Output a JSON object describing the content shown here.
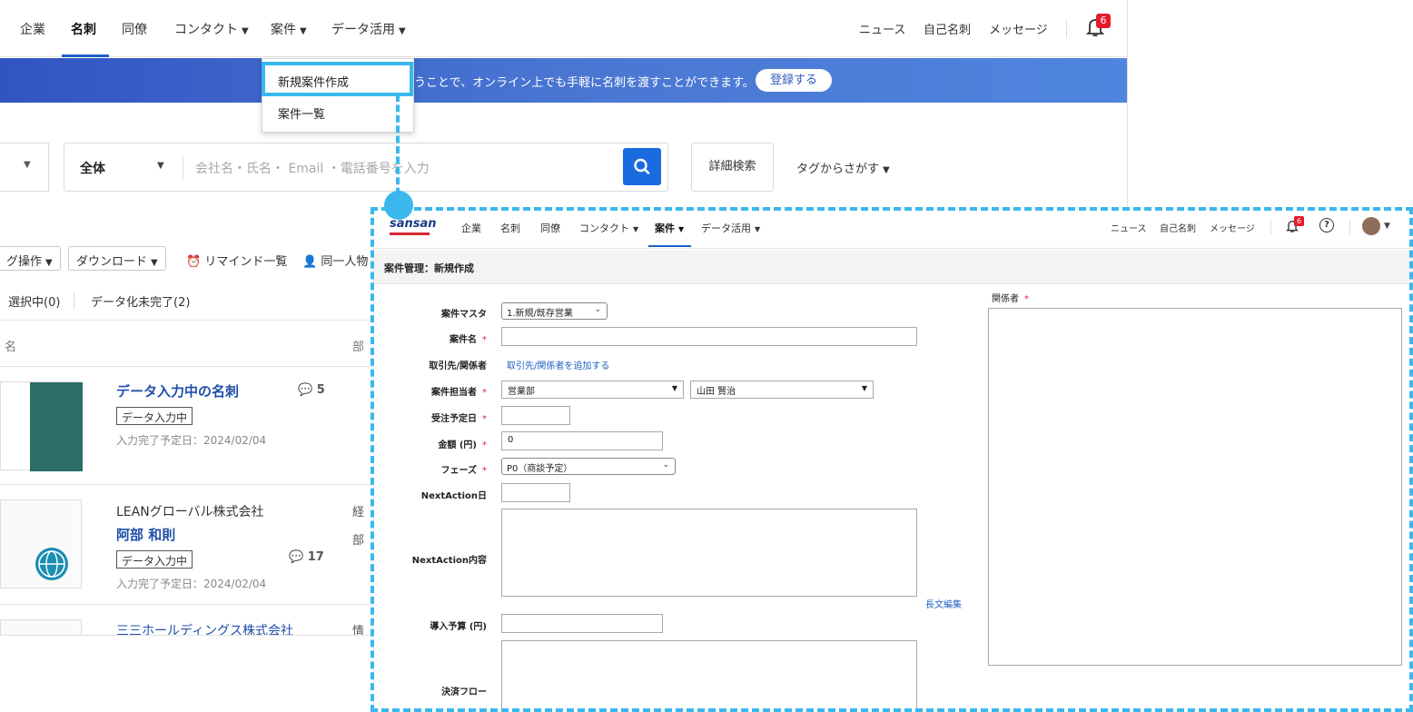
{
  "bg": {
    "nav": {
      "items": [
        "企業",
        "名刺",
        "同僚",
        "コンタクト",
        "案件",
        "データ活用"
      ],
      "right": [
        "ニュース",
        "自己名刺",
        "メッセージ"
      ],
      "notification_count": "6"
    },
    "banner": {
      "text": "うことで、オンライン上でも手軽に名刺を渡すことができます。",
      "button": "登録する"
    },
    "dropdown": [
      "新規案件作成",
      "案件一覧"
    ],
    "search": {
      "scope": "全体",
      "placeholder": "会社名・氏名・ Email ・電話番号を入力",
      "advanced": "詳細検索",
      "tag_search": "タグからさがす"
    },
    "toolbar": {
      "tag_ops": "グ操作",
      "download": "ダウンロード",
      "remind": "リマインド一覧",
      "same_person": "同一人物"
    },
    "filters": [
      "選択中(0)",
      "データ化未完了(2)"
    ],
    "list_headers": [
      "名",
      "部"
    ],
    "rows": [
      {
        "title": "データ入力中の名刺",
        "badge": "データ入力中",
        "date": "入力完了予定日：2024/02/04",
        "count": "5"
      },
      {
        "company": "LEANグローバル株式会社",
        "name": "阿部 和則",
        "badge": "データ入力中",
        "date": "入力完了予定日：2024/02/04",
        "count": "17",
        "dept1": "経",
        "dept2": "部"
      },
      {
        "company": "三三ホールディングス株式会社",
        "dept1": "情"
      }
    ]
  },
  "fg": {
    "logo": "sansan",
    "nav": {
      "items": [
        "企業",
        "名刺",
        "同僚",
        "コンタクト",
        "案件",
        "データ活用"
      ],
      "right": [
        "ニュース",
        "自己名刺",
        "メッセージ"
      ],
      "notification_count": "6"
    },
    "page_title": "案件管理：新規作成",
    "form": {
      "master_label": "案件マスタ",
      "master_value": "1.新規/既存営業",
      "name_label": "案件名",
      "partner_label": "取引先/関係者",
      "partner_link": "取引先/関係者を追加する",
      "owner_label": "案件担当者",
      "owner_dept": "営業部",
      "owner_person": "山田 賢治",
      "date_label": "受注予定日",
      "amount_label": "金額 (円)",
      "amount_value": "0",
      "phase_label": "フェーズ",
      "phase_value": "P0（商談予定）",
      "nextaction_date_label": "NextAction日",
      "nextaction_content_label": "NextAction内容",
      "long_edit_link": "長文編集",
      "budget_label": "導入予算 (円)",
      "flow_label": "決済フロー",
      "related_label": "関係者",
      "required_mark": "*"
    }
  },
  "colors": {
    "accent_blue": "#1b6be0",
    "highlight": "#3ab8ee",
    "badge_red": "#e51b2a"
  }
}
